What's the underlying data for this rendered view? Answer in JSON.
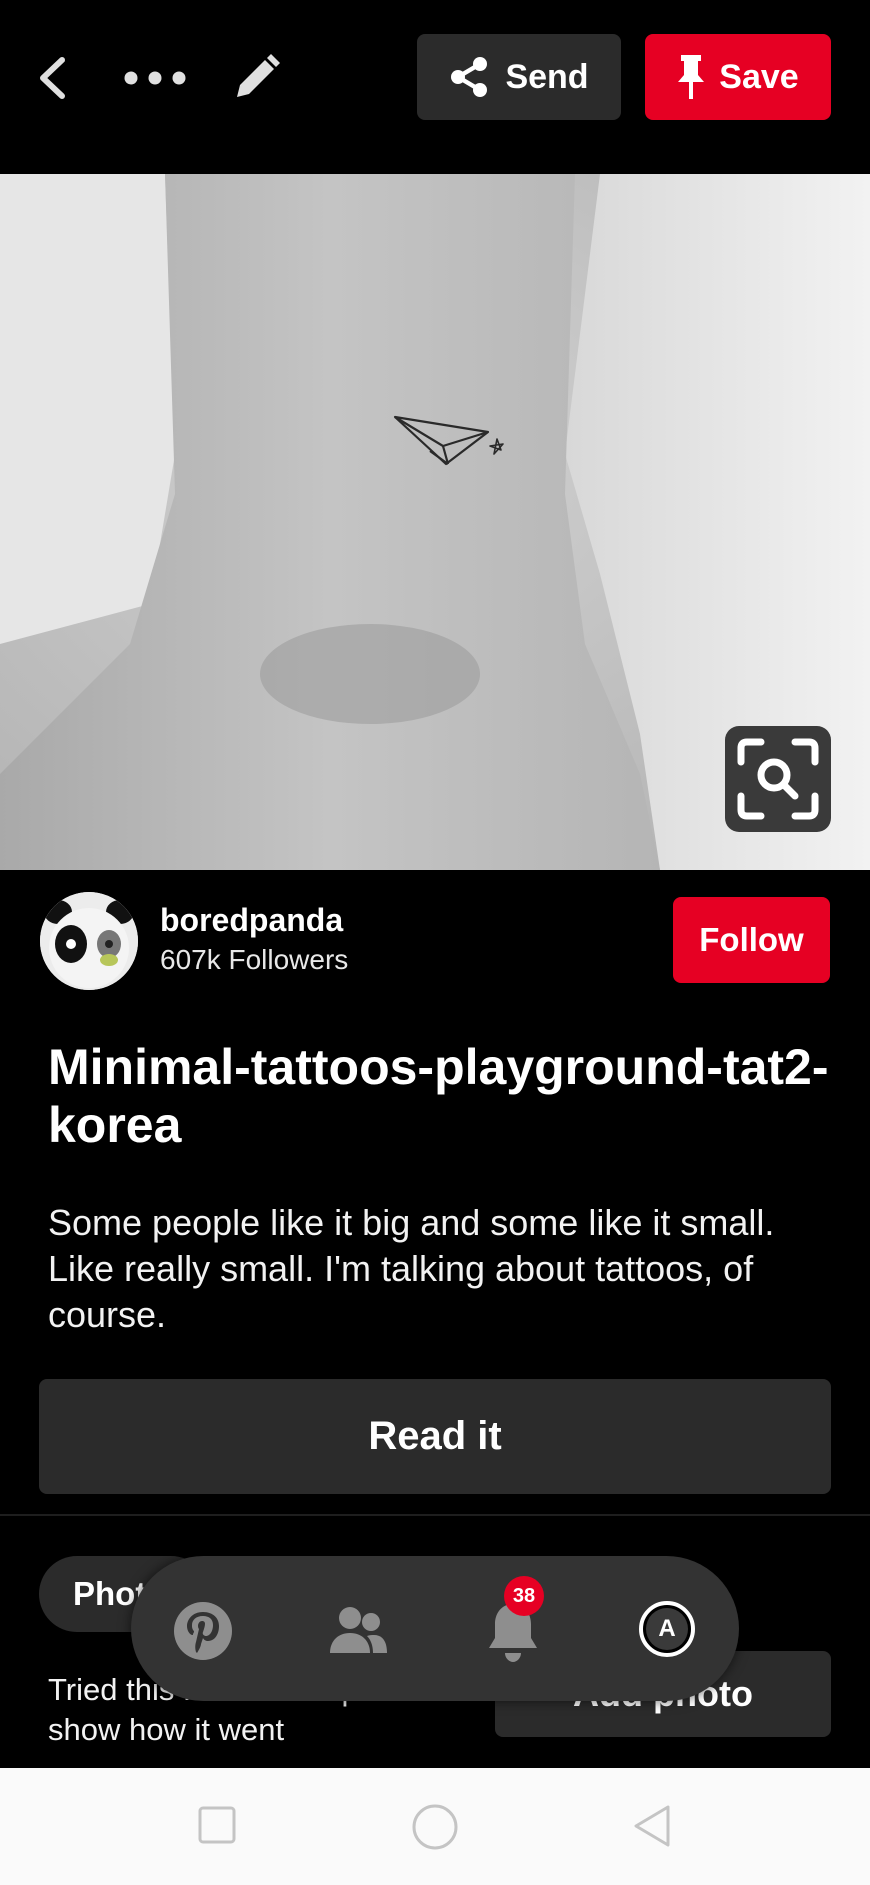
{
  "header": {
    "send_label": "Send",
    "save_label": "Save"
  },
  "creator": {
    "name": "boredpanda",
    "followers": "607k Followers",
    "follow_label": "Follow"
  },
  "pin": {
    "title": "Minimal-tattoos-playground-tat2-korea",
    "description": "Some people like it big and some like it small. Like really small. I'm talking about tattoos, of course.",
    "read_label": "Read it"
  },
  "tried": {
    "tab_label": "Photos",
    "prompt": "Tried this Pin? Add a photo to show how it went",
    "add_label": "Add photo"
  },
  "bottom_nav": {
    "notifications_badge": "38",
    "profile_initial": "A"
  },
  "colors": {
    "brand_red": "#e60023",
    "surface": "#2b2b2b"
  }
}
